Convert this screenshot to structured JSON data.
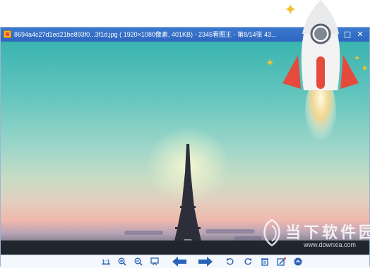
{
  "window": {
    "title": "8694a4c27d1ed21be893f0...3f1d.jpg ( 1920×1080像素, 401KB) - 2345看图王 - 第8/14张 43...",
    "controls": [
      "—",
      "□",
      "✕"
    ]
  },
  "toolbar": {
    "actual_size_label": "1:1",
    "buttons": [
      "actual-size",
      "zoom-in",
      "zoom-out",
      "slideshow",
      "previous",
      "next",
      "rotate-left",
      "rotate-right",
      "delete",
      "edit",
      "more"
    ]
  },
  "watermark": {
    "brand": "当下软件园",
    "url": "www.downxia.com"
  },
  "colors": {
    "titlebar": "#2e66bf",
    "toolbar_icon": "#2a63b8",
    "rocket_body": "#f3f3f3",
    "rocket_fin": "#e64a3c",
    "sparkle": "#f4c22e"
  }
}
